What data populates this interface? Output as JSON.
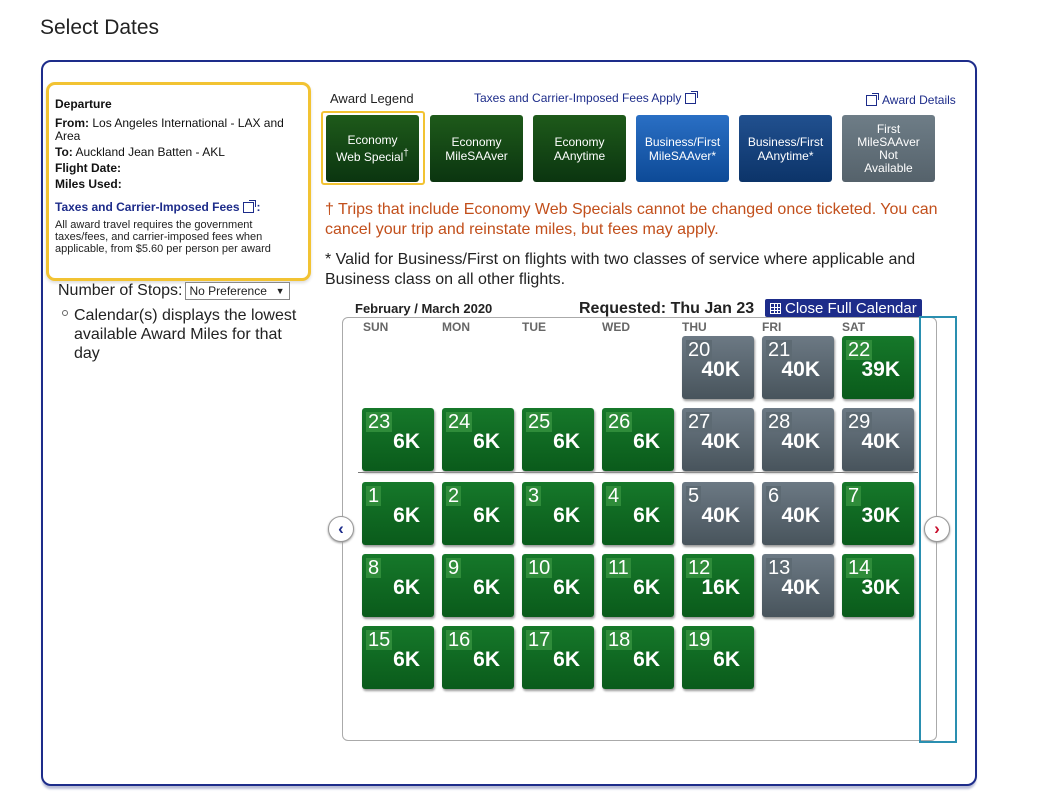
{
  "page_title": "Select Dates",
  "departure": {
    "heading": "Departure",
    "from_label": "From:",
    "from_value": "Los Angeles International - LAX and Area",
    "to_label": "To:",
    "to_value": "Auckland Jean Batten - AKL",
    "flight_date_label": "Flight Date:",
    "miles_used_label": "Miles Used:",
    "fees_link": "Taxes and Carrier-Imposed Fees",
    "fees_colon": ":",
    "fees_note": "All award travel requires the government taxes/fees, and carrier-imposed fees when applicable, from $5.60 per person per award"
  },
  "stops": {
    "label": "Number of Stops:",
    "selected": "No Preference"
  },
  "calendar_note": "Calendar(s) displays the lowest available Award Miles for that day",
  "legend": {
    "title": "Award Legend",
    "taxes_link": "Taxes and Carrier-Imposed Fees Apply",
    "award_details": "Award Details",
    "tiles": [
      {
        "line1": "Economy",
        "line2": "Web Special",
        "sup": "†"
      },
      {
        "line1": "Economy",
        "line2": "MileSAAver"
      },
      {
        "line1": "Economy",
        "line2": "AAnytime"
      },
      {
        "line1": "Business/First",
        "line2": "MileSAAver*"
      },
      {
        "line1": "Business/First",
        "line2": "AAnytime*"
      },
      {
        "line1": "First",
        "line2": "MileSAAver",
        "line3": "Not",
        "line4": "Available"
      }
    ]
  },
  "warning_text": "† Trips that include Economy Web Specials cannot be changed once ticketed. You can cancel your trip and reinstate miles, but fees may apply.",
  "valid_text": "* Valid for Business/First on flights with two classes of service where applicable and Business class on all other flights.",
  "calendar": {
    "month_label": "February / March 2020",
    "requested_label": "Requested:",
    "requested_date": "Thu Jan 23",
    "close_button": "Close Full Calendar",
    "days_of_week": [
      "SUN",
      "MON",
      "TUE",
      "WED",
      "THU",
      "FRI",
      "SAT"
    ],
    "prev_icon": "‹",
    "next_icon": "›",
    "colors": {
      "green": "#0f6b23",
      "gray": "#5b6770",
      "accent": "#1d2c8a",
      "next_arrow": "#c8102e"
    },
    "days": [
      {
        "num": "20",
        "miles": "40K",
        "status": "gray"
      },
      {
        "num": "21",
        "miles": "40K",
        "status": "gray"
      },
      {
        "num": "22",
        "miles": "39K",
        "status": "green"
      },
      {
        "num": "23",
        "miles": "6K",
        "status": "green"
      },
      {
        "num": "24",
        "miles": "6K",
        "status": "green"
      },
      {
        "num": "25",
        "miles": "6K",
        "status": "green"
      },
      {
        "num": "26",
        "miles": "6K",
        "status": "green"
      },
      {
        "num": "27",
        "miles": "40K",
        "status": "gray"
      },
      {
        "num": "28",
        "miles": "40K",
        "status": "gray"
      },
      {
        "num": "29",
        "miles": "40K",
        "status": "gray"
      },
      {
        "num": "1",
        "miles": "6K",
        "status": "green"
      },
      {
        "num": "2",
        "miles": "6K",
        "status": "green"
      },
      {
        "num": "3",
        "miles": "6K",
        "status": "green"
      },
      {
        "num": "4",
        "miles": "6K",
        "status": "green"
      },
      {
        "num": "5",
        "miles": "40K",
        "status": "gray"
      },
      {
        "num": "6",
        "miles": "40K",
        "status": "gray"
      },
      {
        "num": "7",
        "miles": "30K",
        "status": "green"
      },
      {
        "num": "8",
        "miles": "6K",
        "status": "green"
      },
      {
        "num": "9",
        "miles": "6K",
        "status": "green"
      },
      {
        "num": "10",
        "miles": "6K",
        "status": "green"
      },
      {
        "num": "11",
        "miles": "6K",
        "status": "green"
      },
      {
        "num": "12",
        "miles": "16K",
        "status": "green"
      },
      {
        "num": "13",
        "miles": "40K",
        "status": "gray"
      },
      {
        "num": "14",
        "miles": "30K",
        "status": "green"
      },
      {
        "num": "15",
        "miles": "6K",
        "status": "green"
      },
      {
        "num": "16",
        "miles": "6K",
        "status": "green"
      },
      {
        "num": "17",
        "miles": "6K",
        "status": "green"
      },
      {
        "num": "18",
        "miles": "6K",
        "status": "green"
      },
      {
        "num": "19",
        "miles": "6K",
        "status": "green"
      }
    ]
  }
}
